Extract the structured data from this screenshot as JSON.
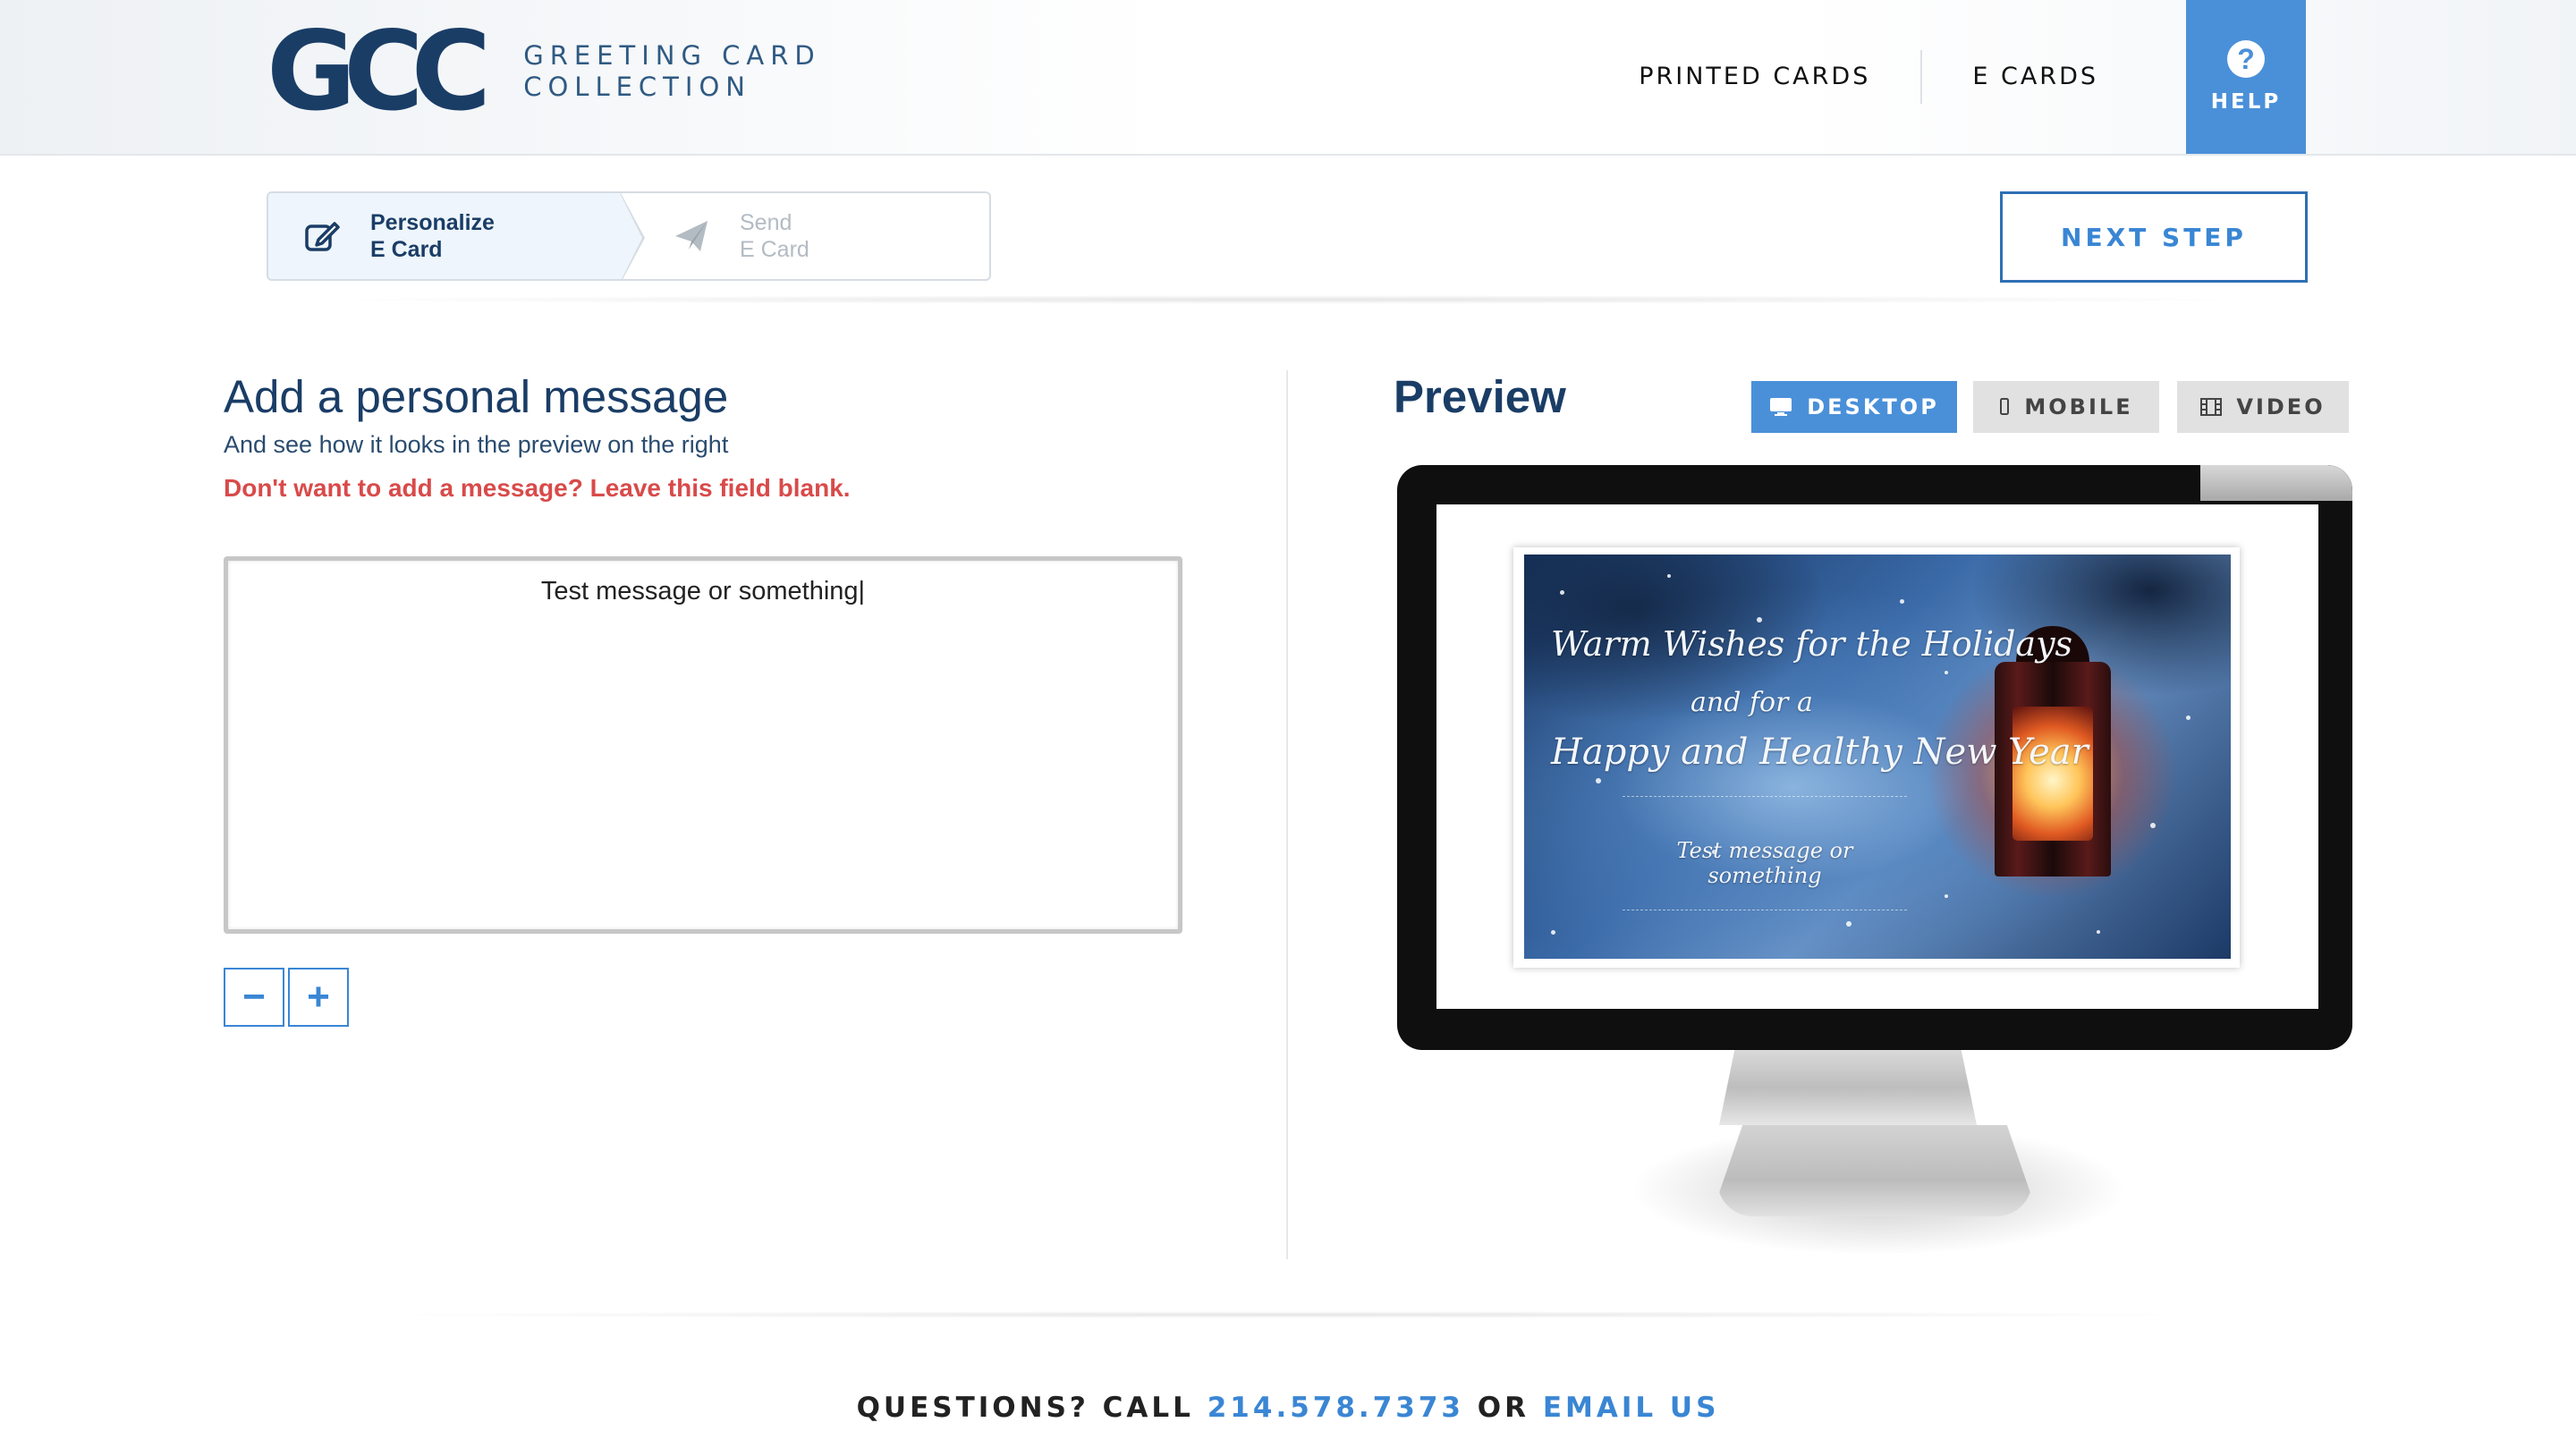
{
  "header": {
    "logo_mark": "GCC",
    "logo_line1": "GREETING CARD",
    "logo_line2": "COLLECTION",
    "nav": [
      "PRINTED CARDS",
      "E CARDS"
    ],
    "help_icon": "?",
    "help_label": "HELP"
  },
  "steps": [
    {
      "line1": "Personalize",
      "line2": "E Card",
      "icon": "edit-icon",
      "active": true
    },
    {
      "line1": "Send",
      "line2": "E Card",
      "icon": "paper-plane-icon",
      "active": false
    }
  ],
  "next_step_label": "NEXT STEP",
  "message": {
    "title": "Add a personal message",
    "subtitle": "And see how it looks in the preview on the right",
    "warning": "Don't want to add a message? Leave this field blank.",
    "value": "Test message or something",
    "decrease_label": "−",
    "increase_label": "+"
  },
  "preview": {
    "title": "Preview",
    "tabs": [
      {
        "label": "DESKTOP",
        "icon": "desktop-icon",
        "selected": true
      },
      {
        "label": "MOBILE",
        "icon": "mobile-icon",
        "selected": false
      },
      {
        "label": "VIDEO",
        "icon": "film-icon",
        "selected": false
      }
    ],
    "card_line1": "Warm Wishes for the Holidays",
    "card_line2": "and for a",
    "card_line3": "Happy and Healthy New Year",
    "card_message": "Test message or something"
  },
  "footer": {
    "prefix": "QUESTIONS? CALL ",
    "phone": "214.578.7373",
    "middle": " OR ",
    "email": "EMAIL US"
  },
  "colors": {
    "accent": "#4a90d9",
    "brand": "#1a3d66",
    "warning": "#d94a4a"
  }
}
